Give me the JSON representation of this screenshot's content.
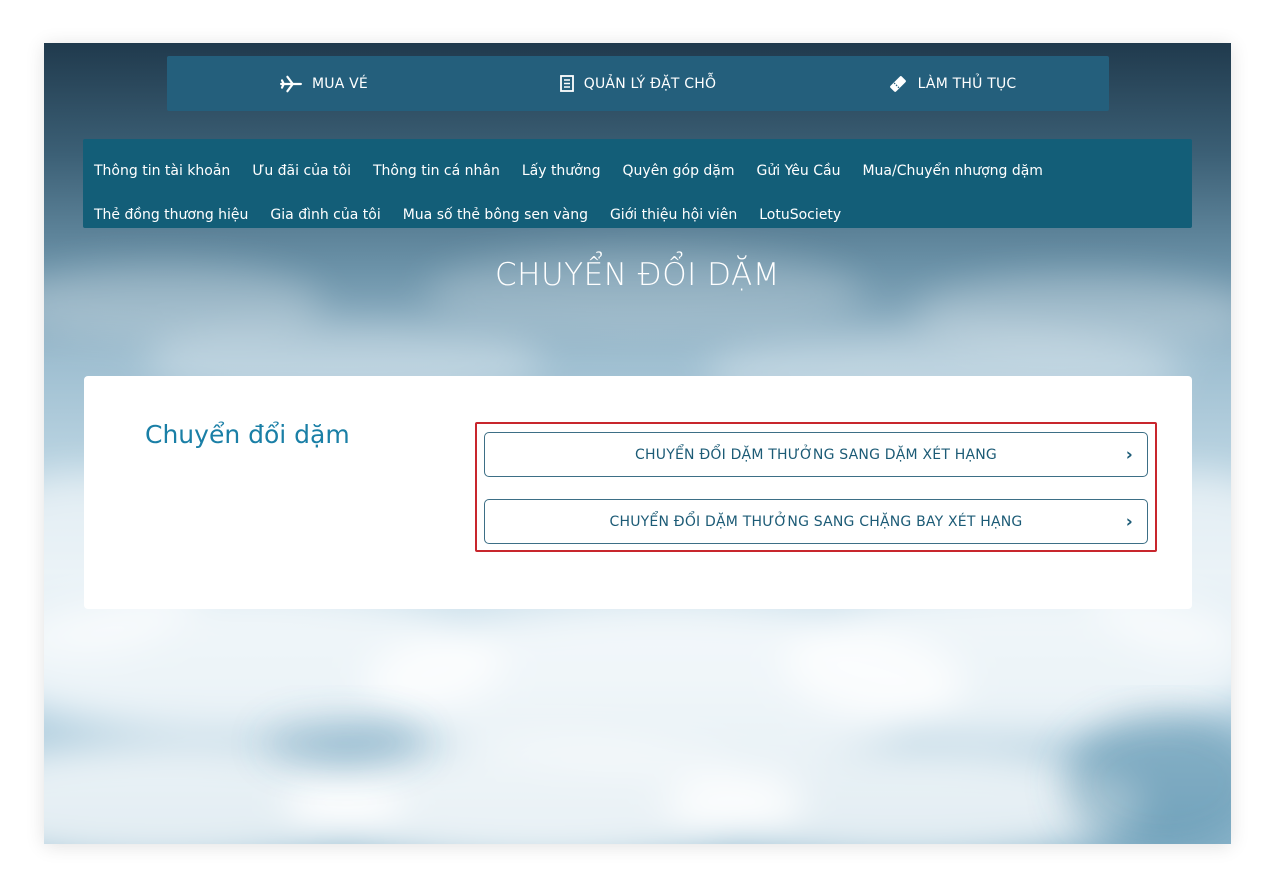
{
  "top_nav": {
    "items": [
      {
        "label": "MUA VÉ",
        "icon": "airplane-icon"
      },
      {
        "label": "QUẢN LÝ ĐẶT CHỖ",
        "icon": "booking-icon"
      },
      {
        "label": "LÀM THỦ TỤC",
        "icon": "ticket-icon"
      }
    ]
  },
  "sub_nav": {
    "row1": [
      "Thông tin tài khoản",
      "Ưu đãi của tôi",
      "Thông tin cá nhân",
      "Lấy thưởng",
      "Quyên góp dặm",
      "Gửi Yêu Cầu",
      "Mua/Chuyển nhượng dặm"
    ],
    "row2": [
      "Thẻ đồng thương hiệu",
      "Gia đình của tôi",
      "Mua số thẻ bông sen vàng",
      "Giới thiệu hội viên",
      "LotuSociety"
    ]
  },
  "page": {
    "title": "CHUYỂN ĐỔI DẶM"
  },
  "card": {
    "title": "Chuyển đổi dặm",
    "options": [
      {
        "label": "CHUYỂN ĐỔI DẶM THƯỞNG SANG DẶM XÉT HẠNG"
      },
      {
        "label": "CHUYỂN ĐỔI DẶM THƯỞNG SANG CHẶNG BAY XÉT HẠNG"
      }
    ]
  },
  "colors": {
    "nav_top": "#245f7c",
    "nav_sub": "#135e78",
    "accent": "#1a7fa6",
    "highlight": "#c8262d"
  }
}
